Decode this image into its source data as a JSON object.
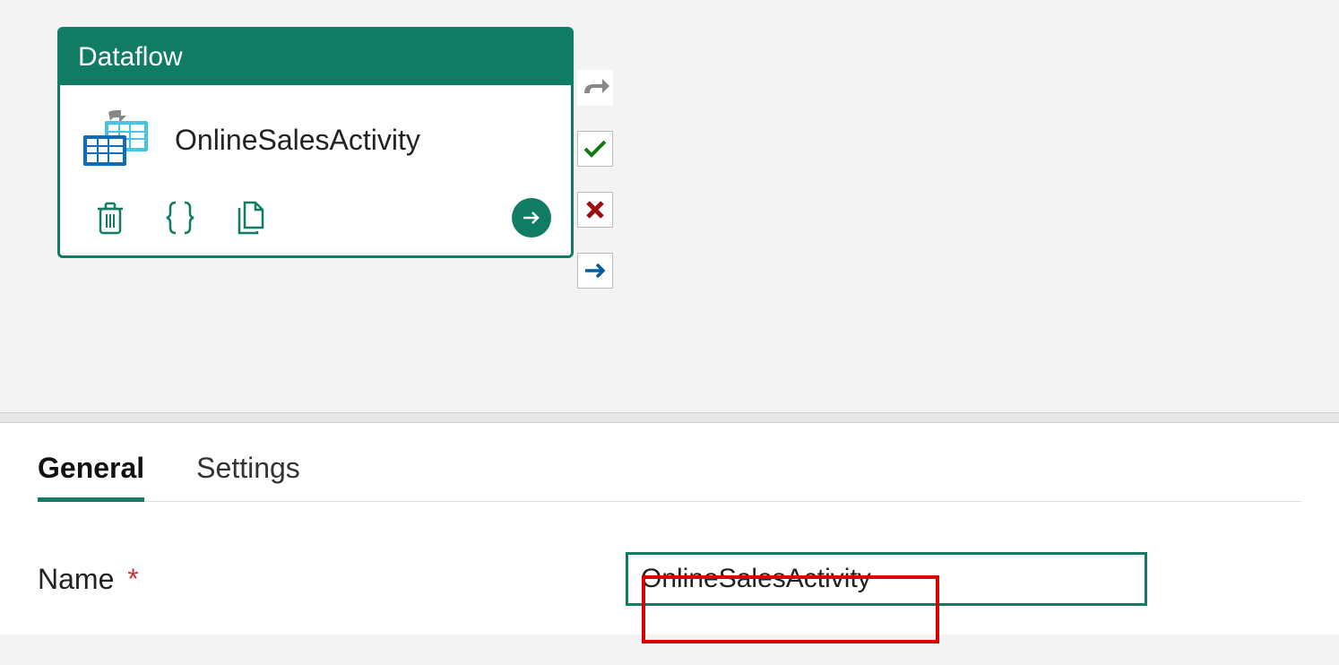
{
  "activity": {
    "type_label": "Dataflow",
    "name": "OnlineSalesActivity"
  },
  "tabs": {
    "general": "General",
    "settings": "Settings"
  },
  "form": {
    "name_label": "Name",
    "name_value": "OnlineSalesActivity"
  },
  "colors": {
    "primary": "#107c63",
    "danger": "#9a0e0e",
    "link": "#005ba1"
  }
}
